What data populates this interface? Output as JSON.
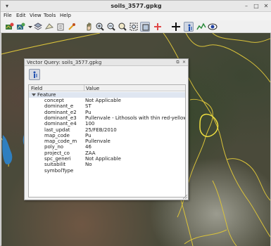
{
  "window": {
    "title": "soils_3577.gpkg"
  },
  "menu": [
    "File",
    "Edit",
    "View",
    "Tools",
    "Help"
  ],
  "toolbar": {
    "icons": [
      "add-layer-icon",
      "add-raster-icon",
      "dropdown-arrow-icon",
      "layers-icon",
      "vector-icon",
      "brush-icon",
      "pan-icon",
      "zoom-in-icon",
      "zoom-out-icon",
      "zoom-layer-icon",
      "zoom-full-icon",
      "zoom-selection-icon",
      "clear-icon",
      "crosshair-icon",
      "identify-icon",
      "profile-icon",
      "eye-icon"
    ]
  },
  "dialog": {
    "title": "Vector Query: soils_3577.gpkg",
    "float_label": "⧉",
    "close_label": "✕",
    "columns": {
      "field": "Field",
      "value": "Value"
    },
    "feature_label": "Feature",
    "rows": [
      {
        "field": "concept",
        "value": "Not Applicable"
      },
      {
        "field": "dominant_e",
        "value": "ST"
      },
      {
        "field": "dominant_e2",
        "value": "Pu"
      },
      {
        "field": "dominant_e3",
        "value": "Pullenvale - Lithosols with thin red-yellow po..."
      },
      {
        "field": "dominant_e4",
        "value": "100"
      },
      {
        "field": "last_updat",
        "value": "25/FEB/2010"
      },
      {
        "field": "map_code",
        "value": "Pu"
      },
      {
        "field": "map_code_m",
        "value": "Pullenvale"
      },
      {
        "field": "poly_no",
        "value": "46"
      },
      {
        "field": "project_co",
        "value": "ZAA"
      },
      {
        "field": "spc_generi",
        "value": "Not Applicable"
      },
      {
        "field": "suitabilit",
        "value": "No"
      },
      {
        "field": "symbolType",
        "value": ""
      }
    ]
  },
  "colors": {
    "polygon_outline": "#d9c23a",
    "selected_row": "#dfe6f1"
  }
}
